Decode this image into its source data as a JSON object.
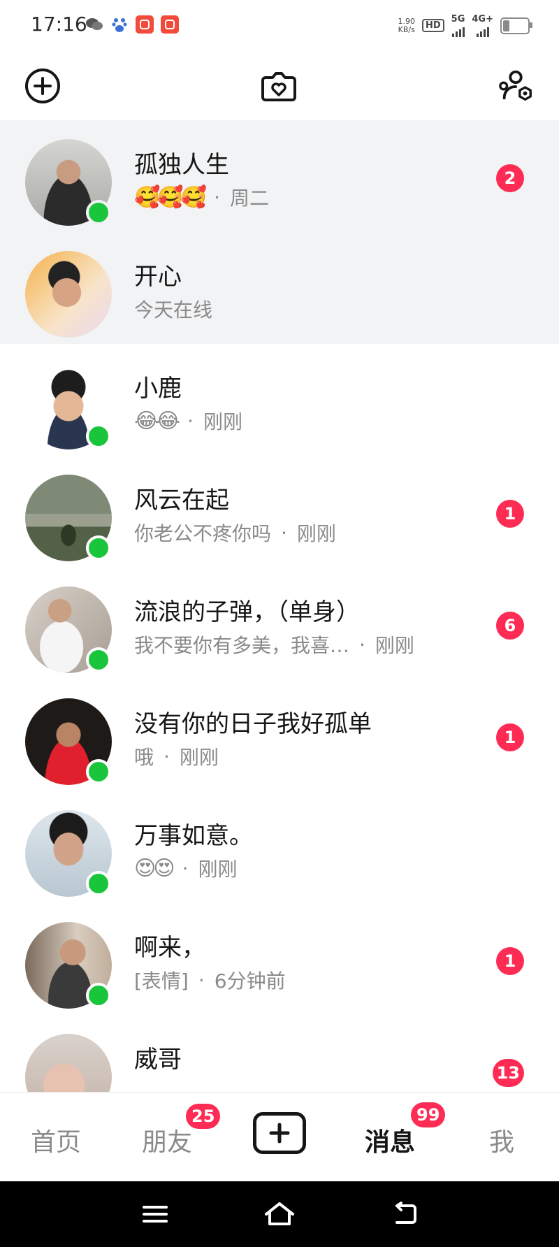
{
  "status_bar": {
    "time": "17:16",
    "net_speed_value": "1.90",
    "net_speed_unit": "KB/s",
    "hd_label": "HD",
    "net1": "5G",
    "net2": "4G+"
  },
  "header": {
    "left_icon": "plus-circle-icon",
    "center_icon": "camera-heart-icon",
    "right_icon": "friend-settings-icon"
  },
  "conversations": [
    {
      "name": "孤独人生",
      "emoji": "🥰🥰🥰",
      "message": "",
      "time": "周二",
      "badge": "2",
      "online": true,
      "highlight": true,
      "avatar_color": "#8a8a8a"
    },
    {
      "name": "开心",
      "emoji": "",
      "message": "今天在线",
      "time": "",
      "badge": "",
      "online": false,
      "highlight": true,
      "avatar_color": "#f2a25a"
    },
    {
      "name": "小鹿",
      "emoji": "😂😂",
      "message": "",
      "time": "刚刚",
      "badge": "",
      "online": true,
      "highlight": false,
      "avatar_color": "#d9c9b8"
    },
    {
      "name": "风云在起",
      "emoji": "",
      "message": "你老公不疼你吗",
      "time": "刚刚",
      "badge": "1",
      "online": true,
      "highlight": false,
      "avatar_color": "#4c6a48"
    },
    {
      "name": "流浪的子弹，（单身）",
      "emoji": "",
      "message": "我不要你有多美，我喜…",
      "time": "刚刚",
      "badge": "6",
      "online": true,
      "highlight": false,
      "avatar_color": "#b9b0a6"
    },
    {
      "name": "没有你的日子我好孤单",
      "emoji": "",
      "message": "哦",
      "time": "刚刚",
      "badge": "1",
      "online": true,
      "highlight": false,
      "avatar_color": "#3a2620"
    },
    {
      "name": "万事如意。",
      "emoji": "😍😍",
      "message": "",
      "time": "刚刚",
      "badge": "",
      "online": true,
      "highlight": false,
      "avatar_color": "#c9d4dc"
    },
    {
      "name": "啊来，",
      "emoji": "",
      "message": "[表情]",
      "time": "6分钟前",
      "badge": "1",
      "online": true,
      "highlight": false,
      "avatar_color": "#9c8a78"
    },
    {
      "name": "威哥",
      "emoji": "",
      "message": "",
      "time": "",
      "badge": "13",
      "online": false,
      "highlight": false,
      "avatar_color": "#e0c4b8"
    }
  ],
  "tabbar": {
    "home": "首页",
    "friends": "朋友",
    "friends_badge": "25",
    "messages": "消息",
    "messages_badge": "99",
    "me": "我"
  },
  "colors": {
    "accent_badge": "#fe2c55",
    "online": "#19c53a",
    "highlight_bg": "#f2f3f4"
  }
}
